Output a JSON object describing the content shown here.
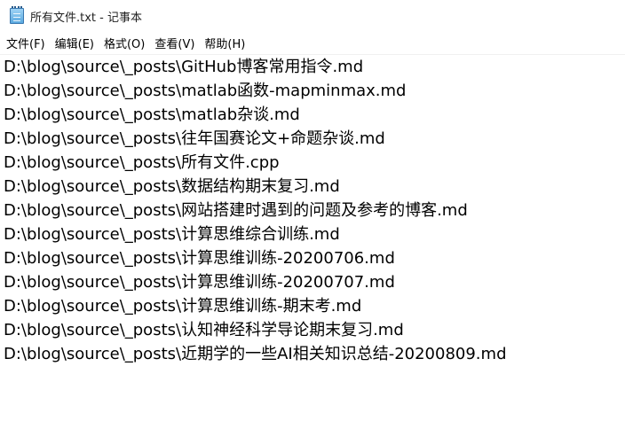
{
  "window": {
    "title": "所有文件.txt - 记事本",
    "icon": "notepad-icon"
  },
  "menu": [
    {
      "label": "文件(F)"
    },
    {
      "label": "编辑(E)"
    },
    {
      "label": "格式(O)"
    },
    {
      "label": "查看(V)"
    },
    {
      "label": "帮助(H)"
    }
  ],
  "editor": {
    "lines": [
      "D:\\blog\\source\\_posts\\GitHub博客常用指令.md",
      "D:\\blog\\source\\_posts\\matlab函数-mapminmax.md",
      "D:\\blog\\source\\_posts\\matlab杂谈.md",
      "D:\\blog\\source\\_posts\\往年国赛论文+命题杂谈.md",
      "D:\\blog\\source\\_posts\\所有文件.cpp",
      "D:\\blog\\source\\_posts\\数据结构期末复习.md",
      "D:\\blog\\source\\_posts\\网站搭建时遇到的问题及参考的博客.md",
      "D:\\blog\\source\\_posts\\计算思维综合训练.md",
      "D:\\blog\\source\\_posts\\计算思维训练-20200706.md",
      "D:\\blog\\source\\_posts\\计算思维训练-20200707.md",
      "D:\\blog\\source\\_posts\\计算思维训练-期末考.md",
      "D:\\blog\\source\\_posts\\认知神经科学导论期末复习.md",
      "D:\\blog\\source\\_posts\\近期学的一些AI相关知识总结-20200809.md"
    ]
  }
}
